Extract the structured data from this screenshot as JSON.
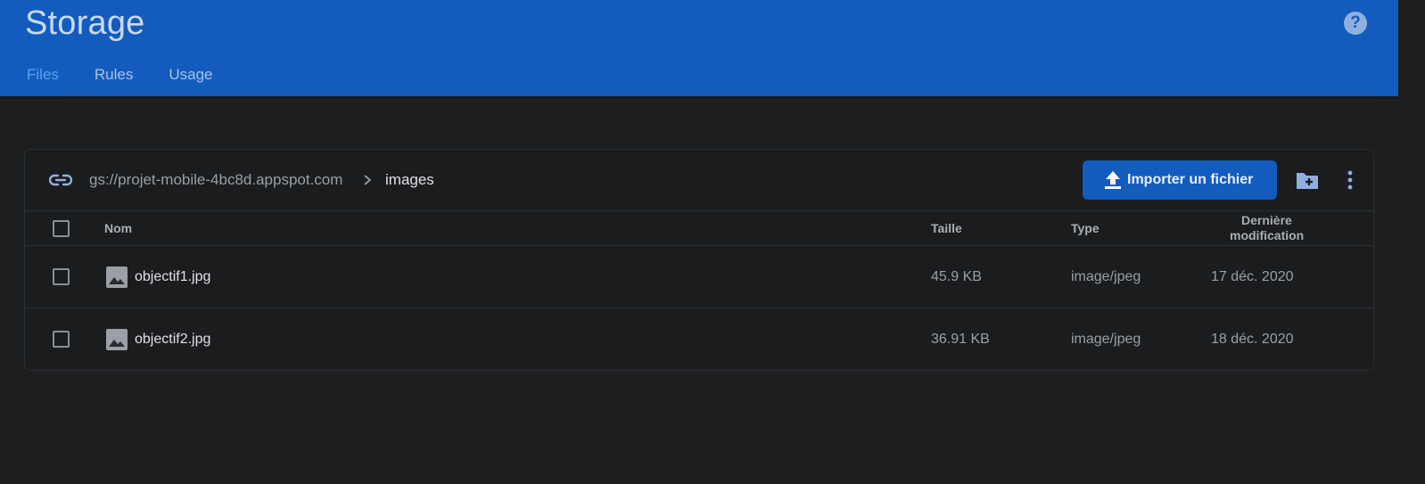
{
  "header": {
    "title": "Storage",
    "tabs": [
      {
        "label": "Files",
        "active": true
      },
      {
        "label": "Rules",
        "active": false
      },
      {
        "label": "Usage",
        "active": false
      }
    ],
    "help_label": "?"
  },
  "toolbar": {
    "bucket_path": "gs://projet-mobile-4bc8d.appspot.com",
    "current_folder": "images",
    "upload_label": "Importer un fichier"
  },
  "table": {
    "headers": {
      "name": "Nom",
      "size": "Taille",
      "type": "Type",
      "modified_line1": "Dernière",
      "modified_line2": "modification"
    },
    "rows": [
      {
        "name": "objectif1.jpg",
        "size": "45.9 KB",
        "type": "image/jpeg",
        "modified": "17 déc. 2020"
      },
      {
        "name": "objectif2.jpg",
        "size": "36.91 KB",
        "type": "image/jpeg",
        "modified": "18 déc. 2020"
      }
    ]
  },
  "colors": {
    "header_bg": "#135cbd",
    "page_bg": "#1c1e1f",
    "active_tab": "#5aa3f2",
    "button_bg": "#135cbd"
  },
  "icons": [
    "link-icon",
    "chevron-right-icon",
    "upload-icon",
    "new-folder-icon",
    "more-vert-icon",
    "help-icon",
    "image-file-icon"
  ]
}
